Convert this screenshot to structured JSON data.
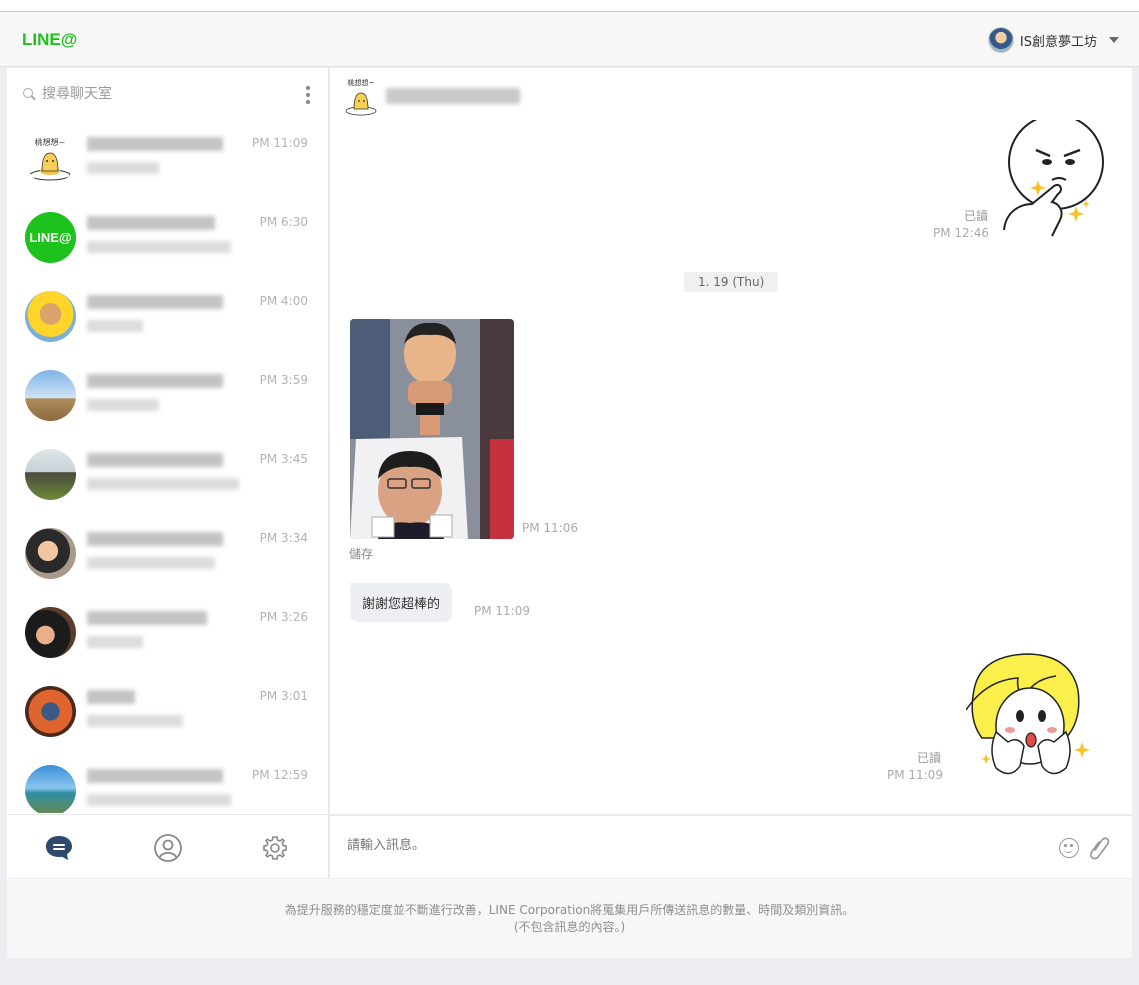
{
  "app": {
    "logo": "LINE@",
    "account_name": "IS創意夢工坊",
    "brand_color": "#1dc21d"
  },
  "sidebar": {
    "search_placeholder": "搜尋聊天室",
    "chats": [
      {
        "time": "PM 11:09",
        "avatar": "egg-sticker"
      },
      {
        "time": "PM 6:30",
        "avatar": "line-at-logo"
      },
      {
        "time": "PM 4:00",
        "avatar": "person-photo"
      },
      {
        "time": "PM 3:59",
        "avatar": "person-photo"
      },
      {
        "time": "PM 3:45",
        "avatar": "person-photo"
      },
      {
        "time": "PM 3:34",
        "avatar": "person-photo"
      },
      {
        "time": "PM 3:26",
        "avatar": "person-photo"
      },
      {
        "time": "PM 3:01",
        "avatar": "person-photo"
      },
      {
        "time": "PM 12:59",
        "avatar": "person-photo"
      }
    ],
    "line_at_avatar_text": "LINE@",
    "nav": [
      "chat-icon",
      "profile-icon",
      "settings-icon"
    ]
  },
  "conversation": {
    "messages": {
      "sticker1_read": "已讀",
      "sticker1_time": "PM 12:46",
      "date_divider": "1. 19 (Thu)",
      "photo_time": "PM 11:06",
      "save_link": "儲存",
      "text_message": "謝謝您超棒的",
      "text_time": "PM 11:09",
      "sticker2_read": "已讀",
      "sticker2_time": "PM 11:09"
    },
    "sticker_egg_text": "桃想想~"
  },
  "composer": {
    "placeholder": "請輸入訊息。"
  },
  "footer": {
    "line1": "為提升服務的穩定度並不斷進行改善，LINE Corporation將蒐集用戶所傳送訊息的數量、時間及類別資訊。",
    "line2": "(不包含訊息的內容。)"
  }
}
